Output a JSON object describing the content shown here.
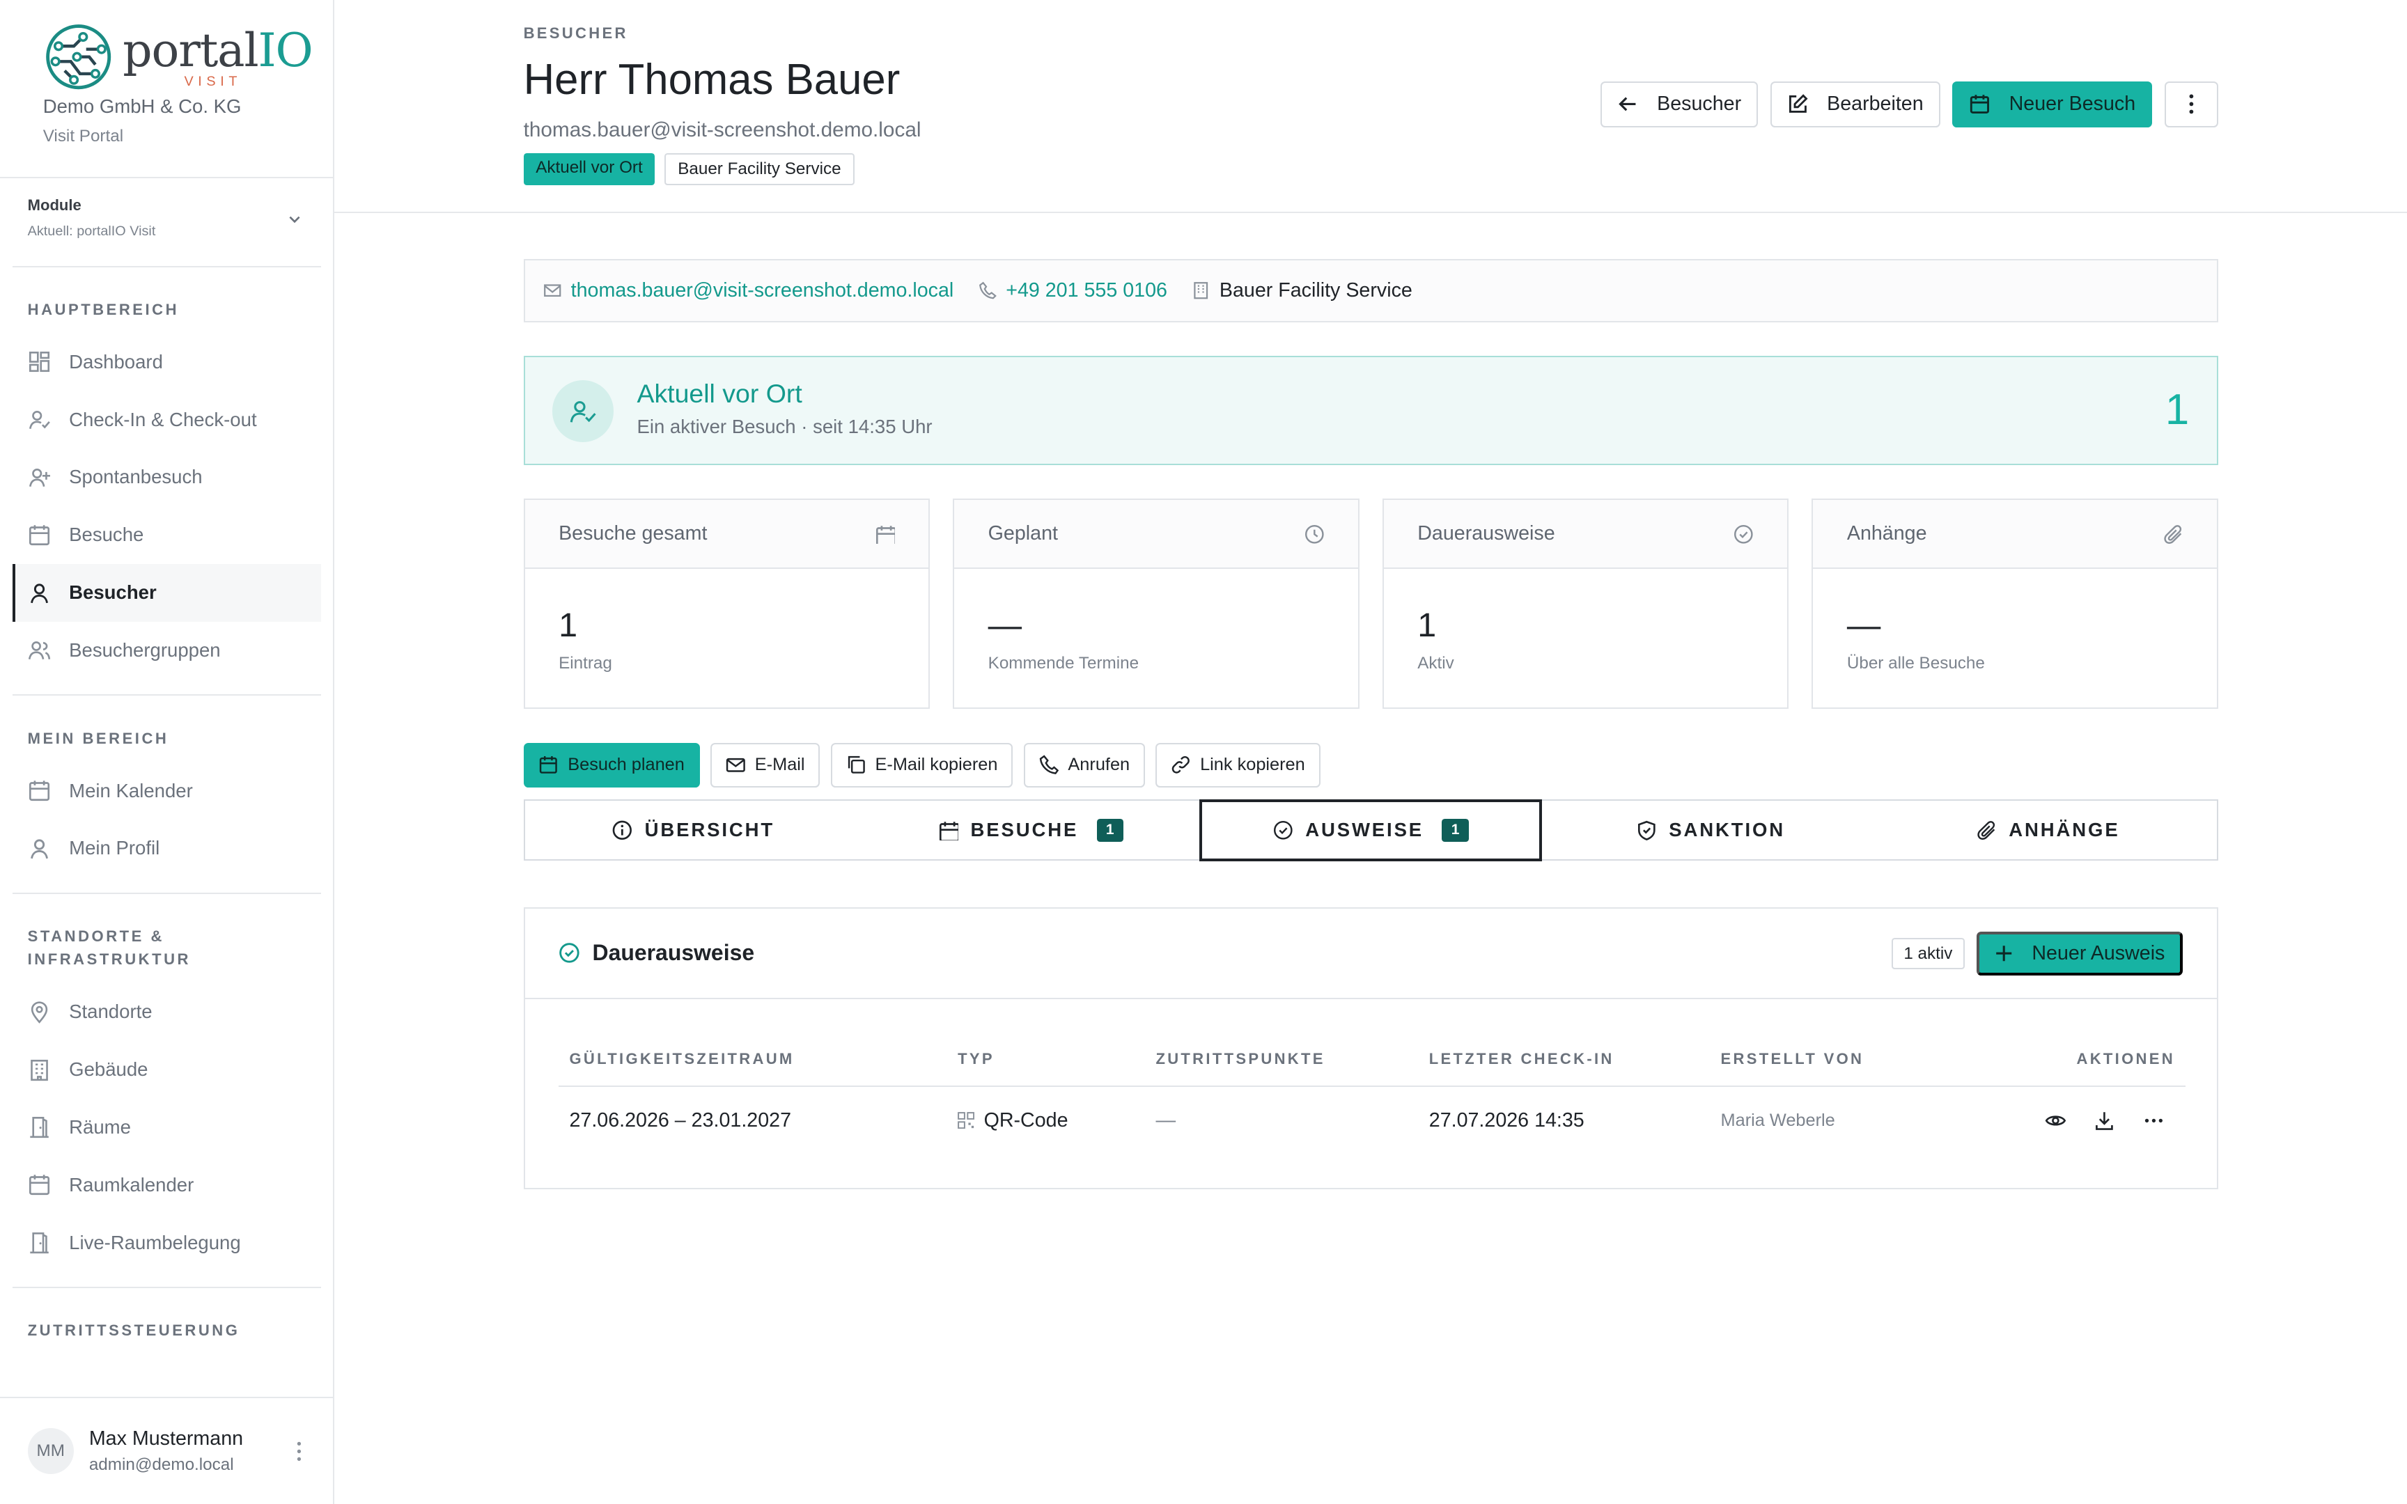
{
  "brand": {
    "logo_word_a": "portal",
    "logo_word_b": "IO",
    "logo_sub": "VISIT",
    "org": "Demo GmbH & Co. KG",
    "portal": "Visit Portal"
  },
  "module": {
    "title": "Module",
    "current": "Aktuell: portalIO Visit"
  },
  "sidebar": {
    "sections": [
      {
        "heading": "HAUPTBEREICH",
        "items": [
          {
            "label": "Dashboard",
            "icon": "dashboard-icon"
          },
          {
            "label": "Check-In & Check-out",
            "icon": "user-check-icon"
          },
          {
            "label": "Spontanbesuch",
            "icon": "user-plus-icon"
          },
          {
            "label": "Besuche",
            "icon": "calendar-icon"
          },
          {
            "label": "Besucher",
            "icon": "user-icon",
            "active": true
          },
          {
            "label": "Besuchergruppen",
            "icon": "users-icon"
          }
        ]
      },
      {
        "heading": "MEIN BEREICH",
        "items": [
          {
            "label": "Mein Kalender",
            "icon": "calendar-icon"
          },
          {
            "label": "Mein Profil",
            "icon": "user-icon"
          }
        ]
      },
      {
        "heading": "STANDORTE & INFRASTRUKTUR",
        "items": [
          {
            "label": "Standorte",
            "icon": "map-pin-icon"
          },
          {
            "label": "Gebäude",
            "icon": "building-icon"
          },
          {
            "label": "Räume",
            "icon": "door-icon"
          },
          {
            "label": "Raumkalender",
            "icon": "calendar-icon"
          },
          {
            "label": "Live-Raumbelegung",
            "icon": "door-icon"
          }
        ]
      },
      {
        "heading": "ZUTRITTSSTEUERUNG",
        "items": []
      }
    ]
  },
  "user": {
    "initials": "MM",
    "name": "Max Mustermann",
    "email": "admin@demo.local"
  },
  "header": {
    "eyebrow": "BESUCHER",
    "title": "Herr Thomas Bauer",
    "email": "thomas.bauer@visit-screenshot.demo.local",
    "badge_status": "Aktuell vor Ort",
    "badge_company": "Bauer Facility Service",
    "btn_back": "Besucher",
    "btn_edit": "Bearbeiten",
    "btn_new_visit": "Neuer Besuch"
  },
  "contact": {
    "email": "thomas.bauer@visit-screenshot.demo.local",
    "phone": "+49 201 555 0106",
    "company": "Bauer Facility Service"
  },
  "onsite": {
    "title": "Aktuell vor Ort",
    "subtitle": "Ein aktiver Besuch · seit 14:35 Uhr",
    "count": "1"
  },
  "stats": [
    {
      "title": "Besuche gesamt",
      "value": "1",
      "label": "Eintrag",
      "icon": "calendar-icon"
    },
    {
      "title": "Geplant",
      "value": "—",
      "label": "Kommende Termine",
      "icon": "clock-icon"
    },
    {
      "title": "Dauerausweise",
      "value": "1",
      "label": "Aktiv",
      "icon": "check-circle-icon"
    },
    {
      "title": "Anhänge",
      "value": "—",
      "label": "Über alle Besuche",
      "icon": "paperclip-icon"
    }
  ],
  "quick_actions": {
    "plan": "Besuch planen",
    "email": "E-Mail",
    "copy_email": "E-Mail kopieren",
    "call": "Anrufen",
    "copy_link": "Link kopieren"
  },
  "tabs": [
    {
      "label": "ÜBERSICHT",
      "count": ""
    },
    {
      "label": "BESUCHE",
      "count": "1"
    },
    {
      "label": "AUSWEISE",
      "count": "1",
      "active": true
    },
    {
      "label": "SANKTION",
      "count": ""
    },
    {
      "label": "ANHÄNGE",
      "count": ""
    }
  ],
  "panel": {
    "title": "Dauerausweise",
    "active_pill": "1 aktiv",
    "btn_new": "Neuer Ausweis",
    "columns": [
      "GÜLTIGKEITSZEITRAUM",
      "TYP",
      "ZUTRITTSPUNKTE",
      "LETZTER CHECK-IN",
      "ERSTELLT VON",
      "AKTIONEN"
    ],
    "rows": [
      {
        "period": "27.06.2026 – 23.01.2027",
        "type": "QR-Code",
        "points": "—",
        "last_checkin": "27.07.2026 14:35",
        "created_by": "Maria Weberle"
      }
    ]
  },
  "colors": {
    "accent": "#17b3a3",
    "accent_dark": "#0f5e58",
    "text": "#1f2328",
    "muted": "#6b727c"
  }
}
